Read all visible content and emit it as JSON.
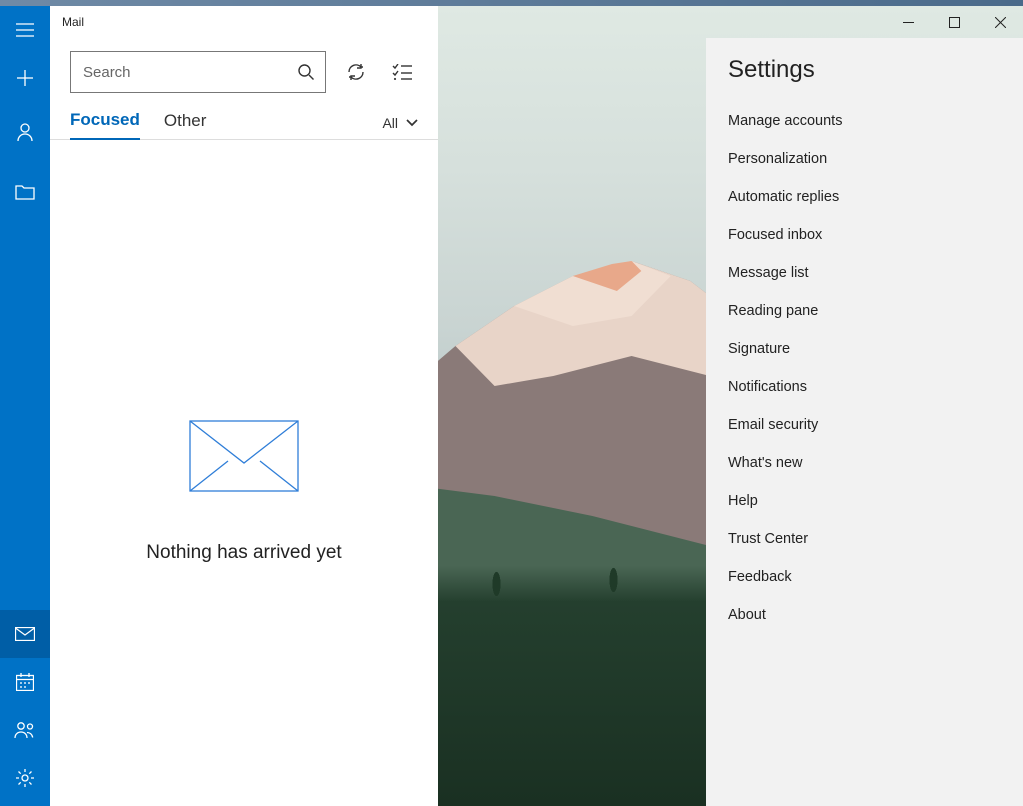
{
  "window": {
    "title": "Mail"
  },
  "rail": {
    "icons": {
      "menu": "menu-icon",
      "compose": "plus-icon",
      "account": "person-icon",
      "folders": "folder-icon",
      "mail": "mail-icon",
      "calendar": "calendar-icon",
      "people": "people-icon",
      "settings": "gear-icon"
    }
  },
  "search": {
    "placeholder": "Search"
  },
  "tabs": {
    "focused": "Focused",
    "other": "Other",
    "filter_label": "All"
  },
  "empty": {
    "message": "Nothing has arrived yet"
  },
  "settings": {
    "title": "Settings",
    "items": [
      "Manage accounts",
      "Personalization",
      "Automatic replies",
      "Focused inbox",
      "Message list",
      "Reading pane",
      "Signature",
      "Notifications",
      "Email security",
      "What's new",
      "Help",
      "Trust Center",
      "Feedback",
      "About"
    ]
  }
}
